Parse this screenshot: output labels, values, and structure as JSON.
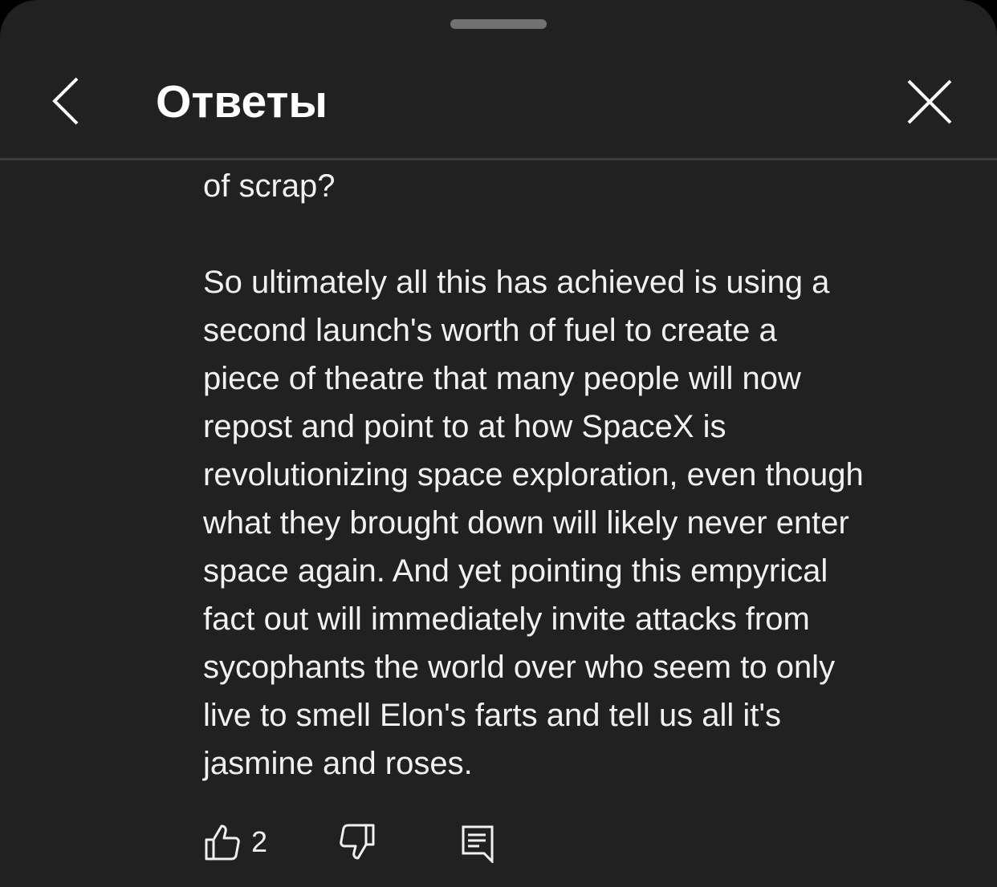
{
  "header": {
    "title": "Ответы"
  },
  "comment": {
    "lines": [
      "of scrap?",
      "",
      "So ultimately all this has achieved is using a",
      "second launch's worth of fuel to create a",
      "piece of theatre that many people will now",
      "repost and point to at how SpaceX is",
      "revolutionizing space exploration, even though",
      "what they brought down will likely never enter",
      "space again. And yet pointing this empyrical",
      "fact out will immediately invite attacks from",
      "sycophants the world over who seem to only",
      "live to smell Elon's farts and tell us all it's",
      "jasmine and roses."
    ]
  },
  "actions": {
    "like_count": "2",
    "icons": {
      "like": "thumbs-up-icon",
      "dislike": "thumbs-down-icon",
      "reply": "comment-icon",
      "back": "chevron-left-icon",
      "close": "close-icon"
    }
  },
  "colors": {
    "background": "#212121",
    "text": "#f1f1f1",
    "divider": "#3d3d3d",
    "handle": "#717171"
  }
}
